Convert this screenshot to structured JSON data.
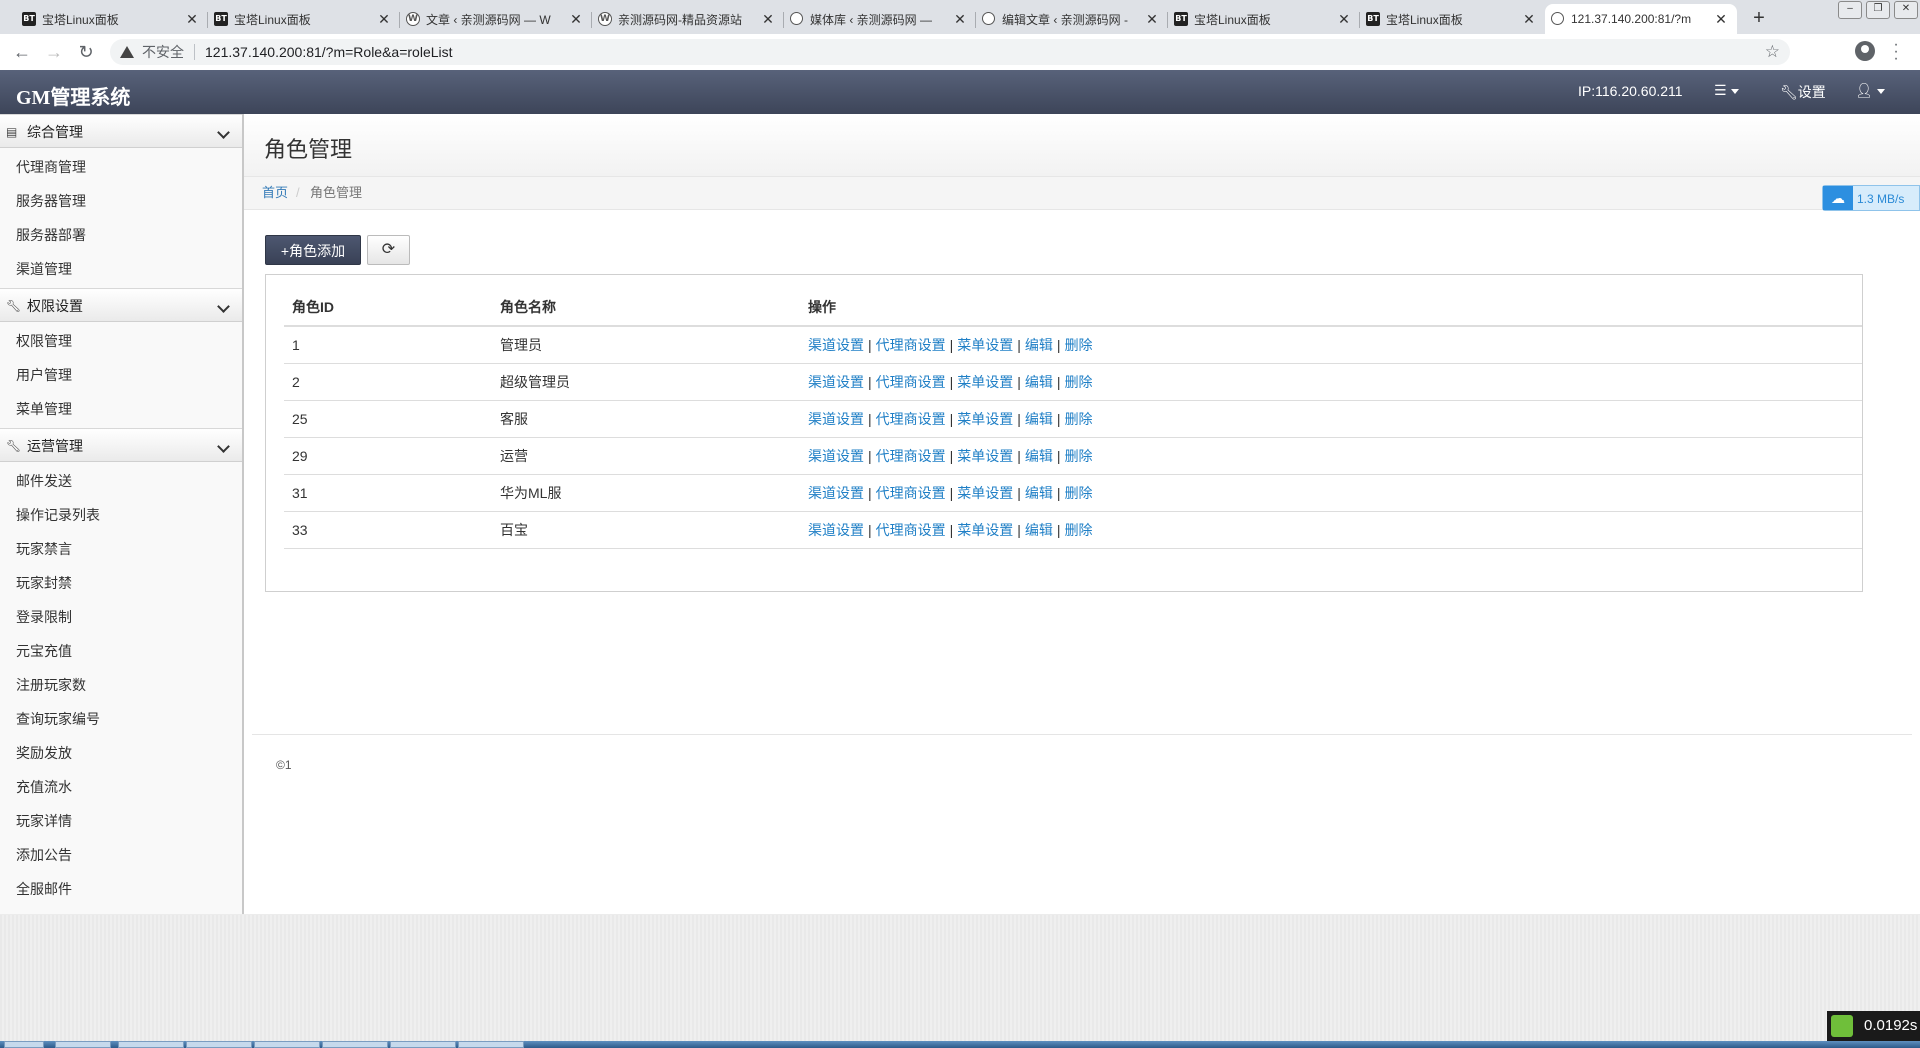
{
  "browser": {
    "tabs": [
      {
        "favicon": "bt-icon",
        "fav_text": "BT",
        "title": "宝塔Linux面板"
      },
      {
        "favicon": "bt-icon",
        "fav_text": "BT",
        "title": "宝塔Linux面板"
      },
      {
        "favicon": "wordpress-icon",
        "fav_text": "W",
        "title": "文章 ‹ 亲测源码网 — W"
      },
      {
        "favicon": "wordpress-icon",
        "fav_text": "W",
        "title": "亲测源码网-精品资源站"
      },
      {
        "favicon": "globe-icon",
        "fav_text": "",
        "title": "媒体库 ‹ 亲测源码网 —"
      },
      {
        "favicon": "globe-icon",
        "fav_text": "",
        "title": "编辑文章 ‹ 亲测源码网 -"
      },
      {
        "favicon": "bt-icon",
        "fav_text": "BT",
        "title": "宝塔Linux面板"
      },
      {
        "favicon": "bt-icon",
        "fav_text": "BT",
        "title": "宝塔Linux面板"
      },
      {
        "favicon": "globe-icon",
        "fav_text": "",
        "title": "121.37.140.200:81/?m"
      }
    ],
    "insecure_label": "不安全",
    "url": "121.37.140.200:81/?m=Role&a=roleList"
  },
  "navbar": {
    "brand": "GM管理系统",
    "ip": "IP:116.20.60.211",
    "settings": "设置"
  },
  "sidebar": {
    "groups": [
      {
        "label": "综合管理",
        "icon": "console-icon",
        "items": [
          "代理商管理",
          "服务器管理",
          "服务器部署",
          "渠道管理"
        ]
      },
      {
        "label": "权限设置",
        "icon": "wrench-icon",
        "items": [
          "权限管理",
          "用户管理",
          "菜单管理"
        ]
      },
      {
        "label": "运营管理",
        "icon": "wrench-icon",
        "items": [
          "邮件发送",
          "操作记录列表",
          "玩家禁言",
          "玩家封禁",
          "登录限制",
          "元宝充值",
          "注册玩家数",
          "查询玩家编号",
          "奖励发放",
          "充值流水",
          "玩家详情",
          "添加公告",
          "全服邮件"
        ]
      }
    ]
  },
  "page": {
    "title": "角色管理",
    "breadcrumb": {
      "home": "首页",
      "sep": "/",
      "current": "角色管理"
    },
    "speed": "1.3 MB/s",
    "add_button": "+角色添加",
    "table": {
      "headers": [
        "角色ID",
        "角色名称",
        "操作"
      ],
      "rows": [
        {
          "id": "1",
          "name": "管理员"
        },
        {
          "id": "2",
          "name": "超级管理员"
        },
        {
          "id": "25",
          "name": "客服"
        },
        {
          "id": "29",
          "name": "运营"
        },
        {
          "id": "31",
          "name": "华为ML服"
        },
        {
          "id": "33",
          "name": "百宝"
        }
      ],
      "actions": [
        "渠道设置",
        "代理商设置",
        "菜单设置",
        "编辑",
        "删除"
      ],
      "action_separator": "|"
    },
    "copyright": "©1"
  },
  "timer": "0.0192s"
}
